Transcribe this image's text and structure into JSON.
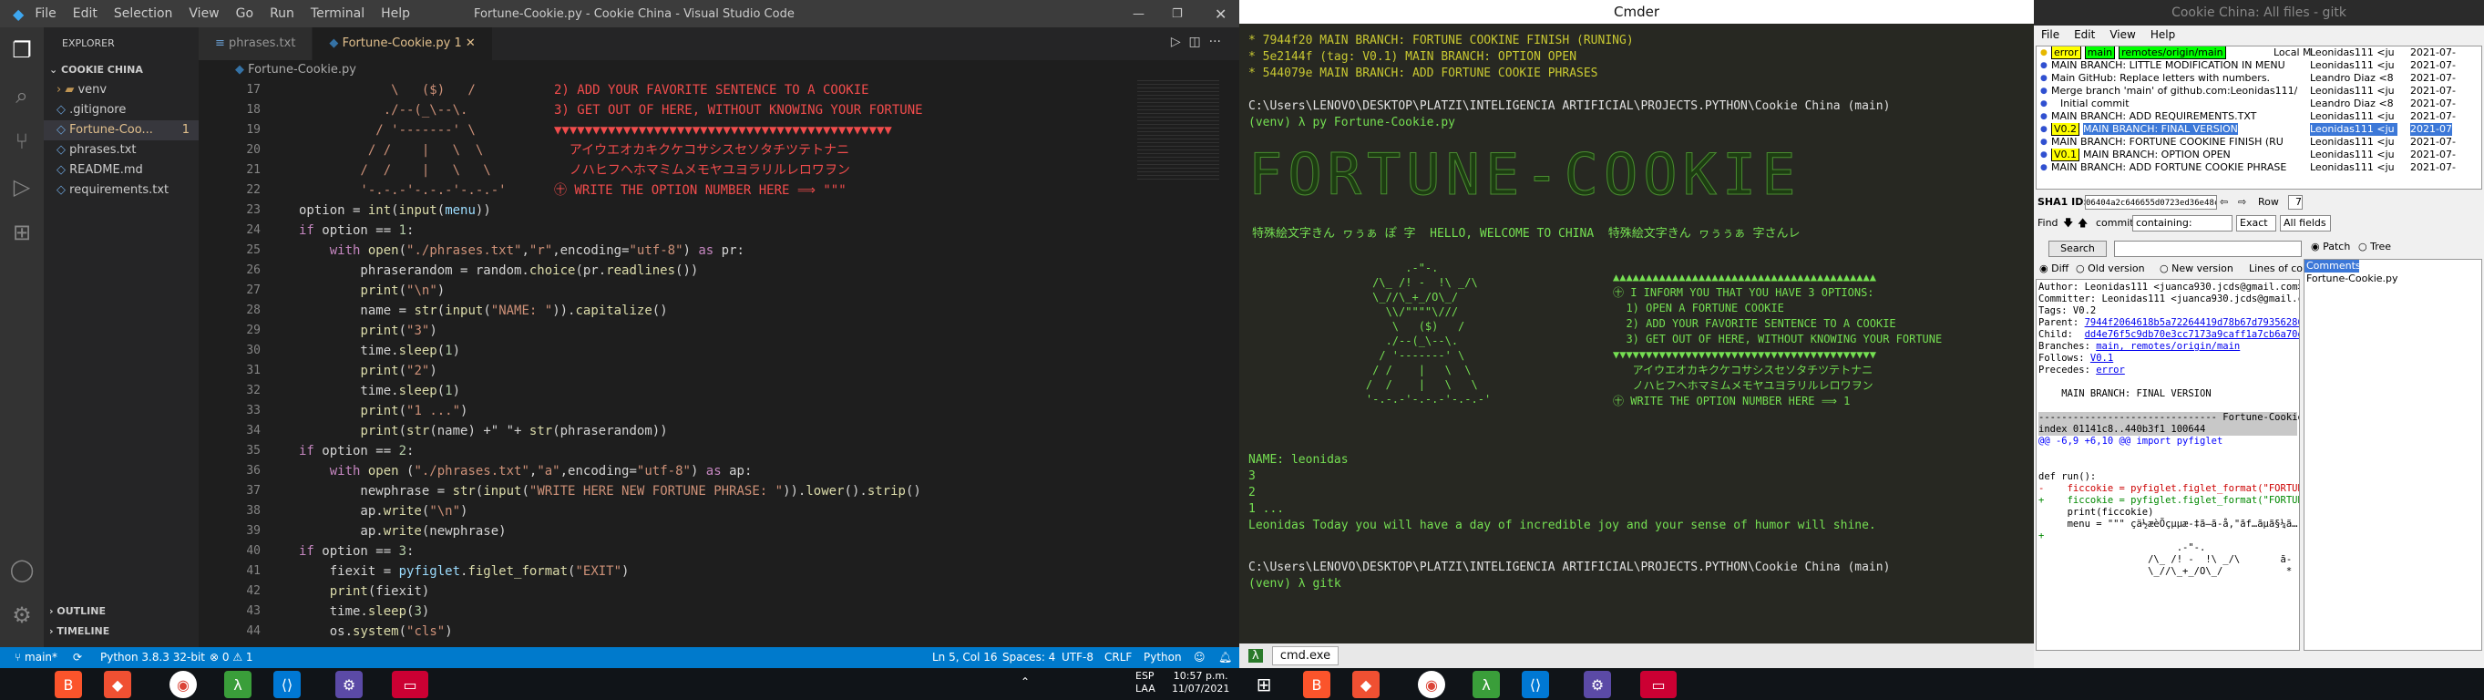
{
  "vscode": {
    "title": "Fortune-Cookie.py - Cookie China - Visual Studio Code",
    "menu": [
      "File",
      "Edit",
      "Selection",
      "View",
      "Go",
      "Run",
      "Terminal",
      "Help"
    ],
    "explorer_title": "EXPLORER",
    "project": "COOKIE CHINA",
    "files": [
      {
        "name": "venv",
        "kind": "folder"
      },
      {
        "name": ".gitignore",
        "kind": "file"
      },
      {
        "name": "Fortune-Coo...",
        "kind": "active",
        "badge": "1"
      },
      {
        "name": "phrases.txt",
        "kind": "file"
      },
      {
        "name": "README.md",
        "kind": "file"
      },
      {
        "name": "requirements.txt",
        "kind": "file"
      }
    ],
    "outline": "OUTLINE",
    "timeline": "TIMELINE",
    "tabs": [
      "phrases.txt",
      "Fortune-Cookie.py 1"
    ],
    "breadcrumb": "Fortune-Cookie.py",
    "line_numbers": [
      "17",
      "18",
      "19",
      "20",
      "21",
      "22",
      "23",
      "24",
      "25",
      "26",
      "27",
      "28",
      "29",
      "30",
      "31",
      "32",
      "33",
      "34",
      "35",
      "36",
      "37",
      "38",
      "39",
      "40",
      "41",
      "42",
      "43",
      "44"
    ],
    "ascii_left": [
      "            \\   ($)   /",
      "           ./--(_\\--\\.",
      "          / '-------' \\",
      "         / /    |   \\  \\",
      "        /  /    |   \\   \\",
      "        '-.-.-'-.-.-'-.-.-'"
    ],
    "ascii_right": [
      "2) ADD YOUR FAVORITE SENTENCE TO A COOKIE",
      "3) GET OUT OF HERE, WITHOUT KNOWING YOUR FORTUNE",
      "▼▼▼▼▼▼▼▼▼▼▼▼▼▼▼▼▼▼▼▼▼▼▼▼▼▼▼▼▼▼▼▼▼▼▼▼▼▼▼▼▼▼▼▼",
      "  アイウエオカキクケコサシスセソタチツテトナニ",
      "  ノハヒフヘホマミムメモヤユヨラリルレロワヲン",
      "㊉ WRITE THE OPTION NUMBER HERE ⟹ \"\"\""
    ],
    "code": [
      [
        "option = ",
        [
          "fn",
          "int"
        ],
        "(",
        [
          "fn",
          "input"
        ],
        "(",
        [
          "vr",
          "menu"
        ],
        "))"
      ],
      [
        [
          "kw",
          "if"
        ],
        " option == ",
        [
          "nm",
          "1"
        ],
        ":"
      ],
      [
        "    ",
        [
          "kw",
          "with"
        ],
        " ",
        [
          "fn",
          "open"
        ],
        "(",
        [
          "st",
          "\"./phrases.txt\""
        ],
        ",",
        [
          "st",
          "\"r\""
        ],
        ",encoding=",
        [
          "st",
          "\"utf-8\""
        ],
        ") ",
        [
          "kw",
          "as"
        ],
        " pr:"
      ],
      [
        "        phraserandom = random.",
        [
          "fn",
          "choice"
        ],
        "(pr.",
        [
          "fn",
          "readlines"
        ],
        "())"
      ],
      [
        "        ",
        [
          "fn",
          "print"
        ],
        "(",
        [
          "st",
          "\"\\n\""
        ],
        ")"
      ],
      [
        "        name = ",
        [
          "fn",
          "str"
        ],
        "(",
        [
          "fn",
          "input"
        ],
        "(",
        [
          "st",
          "\"NAME: \""
        ],
        ")).",
        [
          "fn",
          "capitalize"
        ],
        "()"
      ],
      [
        "        ",
        [
          "fn",
          "print"
        ],
        "(",
        [
          "st",
          "\"3\""
        ],
        ")"
      ],
      [
        "        time.",
        [
          "fn",
          "sleep"
        ],
        "(",
        [
          "nm",
          "1"
        ],
        ")"
      ],
      [
        "        ",
        [
          "fn",
          "print"
        ],
        "(",
        [
          "st",
          "\"2\""
        ],
        ")"
      ],
      [
        "        time.",
        [
          "fn",
          "sleep"
        ],
        "(",
        [
          "nm",
          "1"
        ],
        ")"
      ],
      [
        "        ",
        [
          "fn",
          "print"
        ],
        "(",
        [
          "st",
          "\"1 ...\""
        ],
        ")"
      ],
      [
        "        ",
        [
          "fn",
          "print"
        ],
        "(",
        [
          "fn",
          "str"
        ],
        "(name) +\" \"+ ",
        [
          "fn",
          "str"
        ],
        "(phraserandom))"
      ],
      [
        [
          "kw",
          "if"
        ],
        " option == ",
        [
          "nm",
          "2"
        ],
        ":"
      ],
      [
        "    ",
        [
          "kw",
          "with"
        ],
        " ",
        [
          "fn",
          "open"
        ],
        " (",
        [
          "st",
          "\"./phrases.txt\""
        ],
        ",",
        [
          "st",
          "\"a\""
        ],
        ",encoding=",
        [
          "st",
          "\"utf-8\""
        ],
        ") ",
        [
          "kw",
          "as"
        ],
        " ap:"
      ],
      [
        "        newphrase = ",
        [
          "fn",
          "str"
        ],
        "(",
        [
          "fn",
          "input"
        ],
        "(",
        [
          "st",
          "\"WRITE HERE NEW FORTUNE PHRASE: \""
        ],
        ")).",
        [
          "fn",
          "lower"
        ],
        "().",
        [
          "fn",
          "strip"
        ],
        "()"
      ],
      [
        "        ap.",
        [
          "fn",
          "write"
        ],
        "(",
        [
          "st",
          "\"\\n\""
        ],
        ")"
      ],
      [
        "        ap.",
        [
          "fn",
          "write"
        ],
        "(newphrase)"
      ],
      [
        [
          "kw",
          "if"
        ],
        " option == ",
        [
          "nm",
          "3"
        ],
        ":"
      ],
      [
        "    fiexit = ",
        [
          "vr",
          "pyfiglet"
        ],
        ".",
        [
          "fn",
          "figlet_format"
        ],
        "(",
        [
          "st",
          "\"EXIT\""
        ],
        ")"
      ],
      [
        "    ",
        [
          "fn",
          "print"
        ],
        "(fiexit)"
      ],
      [
        "    time.",
        [
          "fn",
          "sleep"
        ],
        "(",
        [
          "nm",
          "3"
        ],
        ")"
      ],
      [
        "    os.",
        [
          "fn",
          "system"
        ],
        "(",
        [
          "st",
          "\"cls\""
        ],
        ")"
      ]
    ],
    "status_left": [
      "main*",
      "Python 3.8.3 32-bit",
      "⊗ 0 ⚠ 1"
    ],
    "status_right": [
      "Ln 5, Col 16",
      "Spaces: 4",
      "UTF-8",
      "CRLF",
      "Python"
    ]
  },
  "cmder": {
    "title": "Cmder",
    "lines": [
      [
        "* 7944f20 MAIN BRANCH: FORTUNE COOKINE FINISH (RUNING)",
        ""
      ],
      [
        "* 5e2144f (tag: V0.1) MAIN BRANCH: OPTION OPEN",
        ""
      ],
      [
        "* 544079e MAIN BRANCH: ADD FORTUNE COOKIE PHRASES",
        ""
      ],
      [
        "",
        ""
      ],
      [
        "C:\\Users\\LENOVO\\DESKTOP\\PLATZI\\INTELIGENCIA ARTIFICIAL\\PROJECTS.PYTHON\\Cookie China (main)",
        "w"
      ],
      [
        "(venv) λ py Fortune-Cookie.py",
        ""
      ]
    ],
    "banner": "FORTUNE-COOKIE",
    "welcome": "特殊絵文字きん ヮぅぁ ぽ 字  HELLO, WELCOME TO CHINA  特殊絵文字きん ヮぅぅぁ 字さんレ",
    "cookie_art": [
      "          .-\"-.",
      "     /\\_ /! -  !\\ _/\\",
      "     \\_//\\_+_/O\\_/",
      "       \\\\/\"\"\"\"\\///",
      "        \\   ($)   /",
      "       ./--(_\\--\\.",
      "      / '-------' \\",
      "     / /    |   \\  \\",
      "    /  /    |   \\   \\",
      "    '-.-.-'-.-.-'-.-.-'"
    ],
    "menu": [
      "▲▲▲▲▲▲▲▲▲▲▲▲▲▲▲▲▲▲▲▲▲▲▲▲▲▲▲▲▲▲▲▲▲▲▲▲▲▲▲▲",
      "㊉ I INFORM YOU THAT YOU HAVE 3 OPTIONS:",
      "  1) OPEN A FORTUNE COOKIE",
      "  2) ADD YOUR FAVORITE SENTENCE TO A COOKIE",
      "  3) GET OUT OF HERE, WITHOUT KNOWING YOUR FORTUNE",
      "▼▼▼▼▼▼▼▼▼▼▼▼▼▼▼▼▼▼▼▼▼▼▼▼▼▼▼▼▼▼▼▼▼▼▼▼▼▼▼▼",
      "   アイウエオカキクケコサシスセソタチツテトナニ",
      "   ノハヒフヘホマミムメモヤユヨラリルレロワヲン",
      "㊉ WRITE THE OPTION NUMBER HERE ⟹ 1"
    ],
    "output": [
      "NAME: leonidas",
      "3",
      "2",
      "1 ...",
      "Leonidas Today you will have a day of incredible joy and your sense of humor will shine."
    ],
    "prompt2": "C:\\Users\\LENOVO\\DESKTOP\\PLATZI\\INTELIGENCIA ARTIFICIAL\\PROJECTS.PYTHON\\Cookie China (main)",
    "cmd2": "(venv) λ gitk",
    "tab": "cmd.exe"
  },
  "gitk": {
    "title": "Cookie China: All files - gitk",
    "menu": [
      "File",
      "Edit",
      "View",
      "Help"
    ],
    "commits": [
      {
        "msg": "error",
        "tags": [
          "main",
          "remotes/origin/main"
        ],
        "author": "Leonidas111 <ju",
        "date": "2021-07-",
        "sel": false,
        "ref": "error"
      },
      {
        "msg": "MAIN BRANCH: LITTLE MODIFICATION IN MENU",
        "author": "Leonidas111 <ju",
        "date": "2021-07-"
      },
      {
        "msg": "Main GitHub: Replace letters with numbers.",
        "author": "Leandro Diaz <8",
        "date": "2021-07-"
      },
      {
        "msg": "Merge branch 'main' of github.com:Leonidas111/F",
        "author": "Leonidas111 <ju",
        "date": "2021-07-"
      },
      {
        "msg": "Initial commit",
        "author": "Leandro Diaz <8",
        "date": "2021-07-"
      },
      {
        "msg": "MAIN BRANCH: ADD REQUIREMENTS.TXT",
        "author": "Leonidas111 <ju",
        "date": "2021-07-"
      },
      {
        "msg": "MAIN BRANCH: FINAL VERSION",
        "tag": "V0.2",
        "author": "Leonidas111 <ju",
        "date": "2021-07",
        "sel": true
      },
      {
        "msg": "MAIN BRANCH: FORTUNE COOKINE FINISH (RU",
        "author": "Leonidas111 <ju",
        "date": "2021-07-"
      },
      {
        "msg": "MAIN BRANCH: OPTION OPEN",
        "tag": "V0.1",
        "author": "Leonidas111 <ju",
        "date": "2021-07-"
      },
      {
        "msg": "MAIN BRANCH: ADD FORTUNE COOKIE PHRASE",
        "author": "Leonidas111 <ju",
        "date": "2021-07-"
      }
    ],
    "local_label": "Local M",
    "sha_label": "SHA1 ID:",
    "sha": "06404a2c646655d0723ed36e48cacb3cb1c276",
    "row_label": "Row",
    "row_val": "7",
    "find_label": "Find",
    "commit_label": "commit",
    "containing": "containing:",
    "exact": "Exact",
    "all_fields": "All fields",
    "search_btn": "Search",
    "diff": "Diff",
    "old": "Old version",
    "new": "New version",
    "lines_ctx": "Lines of context:",
    "patch": "Patch",
    "tree": "Tree",
    "comments": "Comments",
    "file_list": [
      "Fortune-Cookie.py"
    ],
    "details": [
      [
        "Author: Leonidas111 <juanca930.jcds@gmail.com>",
        ""
      ],
      [
        "Committer: Leonidas111 <juanca930.jcds@gmail.co",
        ""
      ],
      [
        "Tags: V0.2",
        ""
      ],
      [
        "Parent: ",
        "7944f2064618b5a72264419d78b67d79356286e"
      ],
      [
        "Child:  ",
        "dd4e76f5c9db70e3cc7173a9caff1a7cb6a70d5"
      ],
      [
        "Branches: ",
        "main, remotes/origin/main"
      ],
      [
        "Follows: ",
        "V0.1"
      ],
      [
        "Precedes: ",
        "error"
      ],
      [
        "",
        ""
      ],
      [
        "    MAIN BRANCH: FINAL VERSION",
        ""
      ],
      [
        "",
        ""
      ],
      [
        "------------------------------- Fortune-Cookie.p",
        ""
      ],
      [
        "index 01141c8..440b3f1 100644",
        ""
      ],
      [
        "@@ -6,9 +6,10 @@ import pyfiglet",
        ""
      ],
      [
        "",
        ""
      ],
      [
        "",
        ""
      ],
      [
        "def run():",
        ""
      ],
      [
        "-    ficcokie = pyfiglet.figlet_format(\"FORTUNE",
        ""
      ],
      [
        "+    ficcokie = pyfiglet.figlet_format(\"FORTUNE",
        ""
      ],
      [
        "     print(ficcokie)",
        ""
      ],
      [
        "     menu = \"\"\" çä½æèÕçµµæ-‡ã—ã-å,\"ãf…ãµã§¼ã…",
        ""
      ],
      [
        "+",
        ""
      ],
      [
        "                        .-\"-.",
        ""
      ],
      [
        "                   /\\_ /! -  !\\ _/\\       ã-",
        ""
      ],
      [
        "                   \\_//\\_+_/O\\_/           *",
        ""
      ]
    ]
  },
  "taskbar": {
    "lang": "ESP",
    "lang2": "LAA",
    "time": "10:57 p.m.",
    "date": "11/07/2021"
  }
}
